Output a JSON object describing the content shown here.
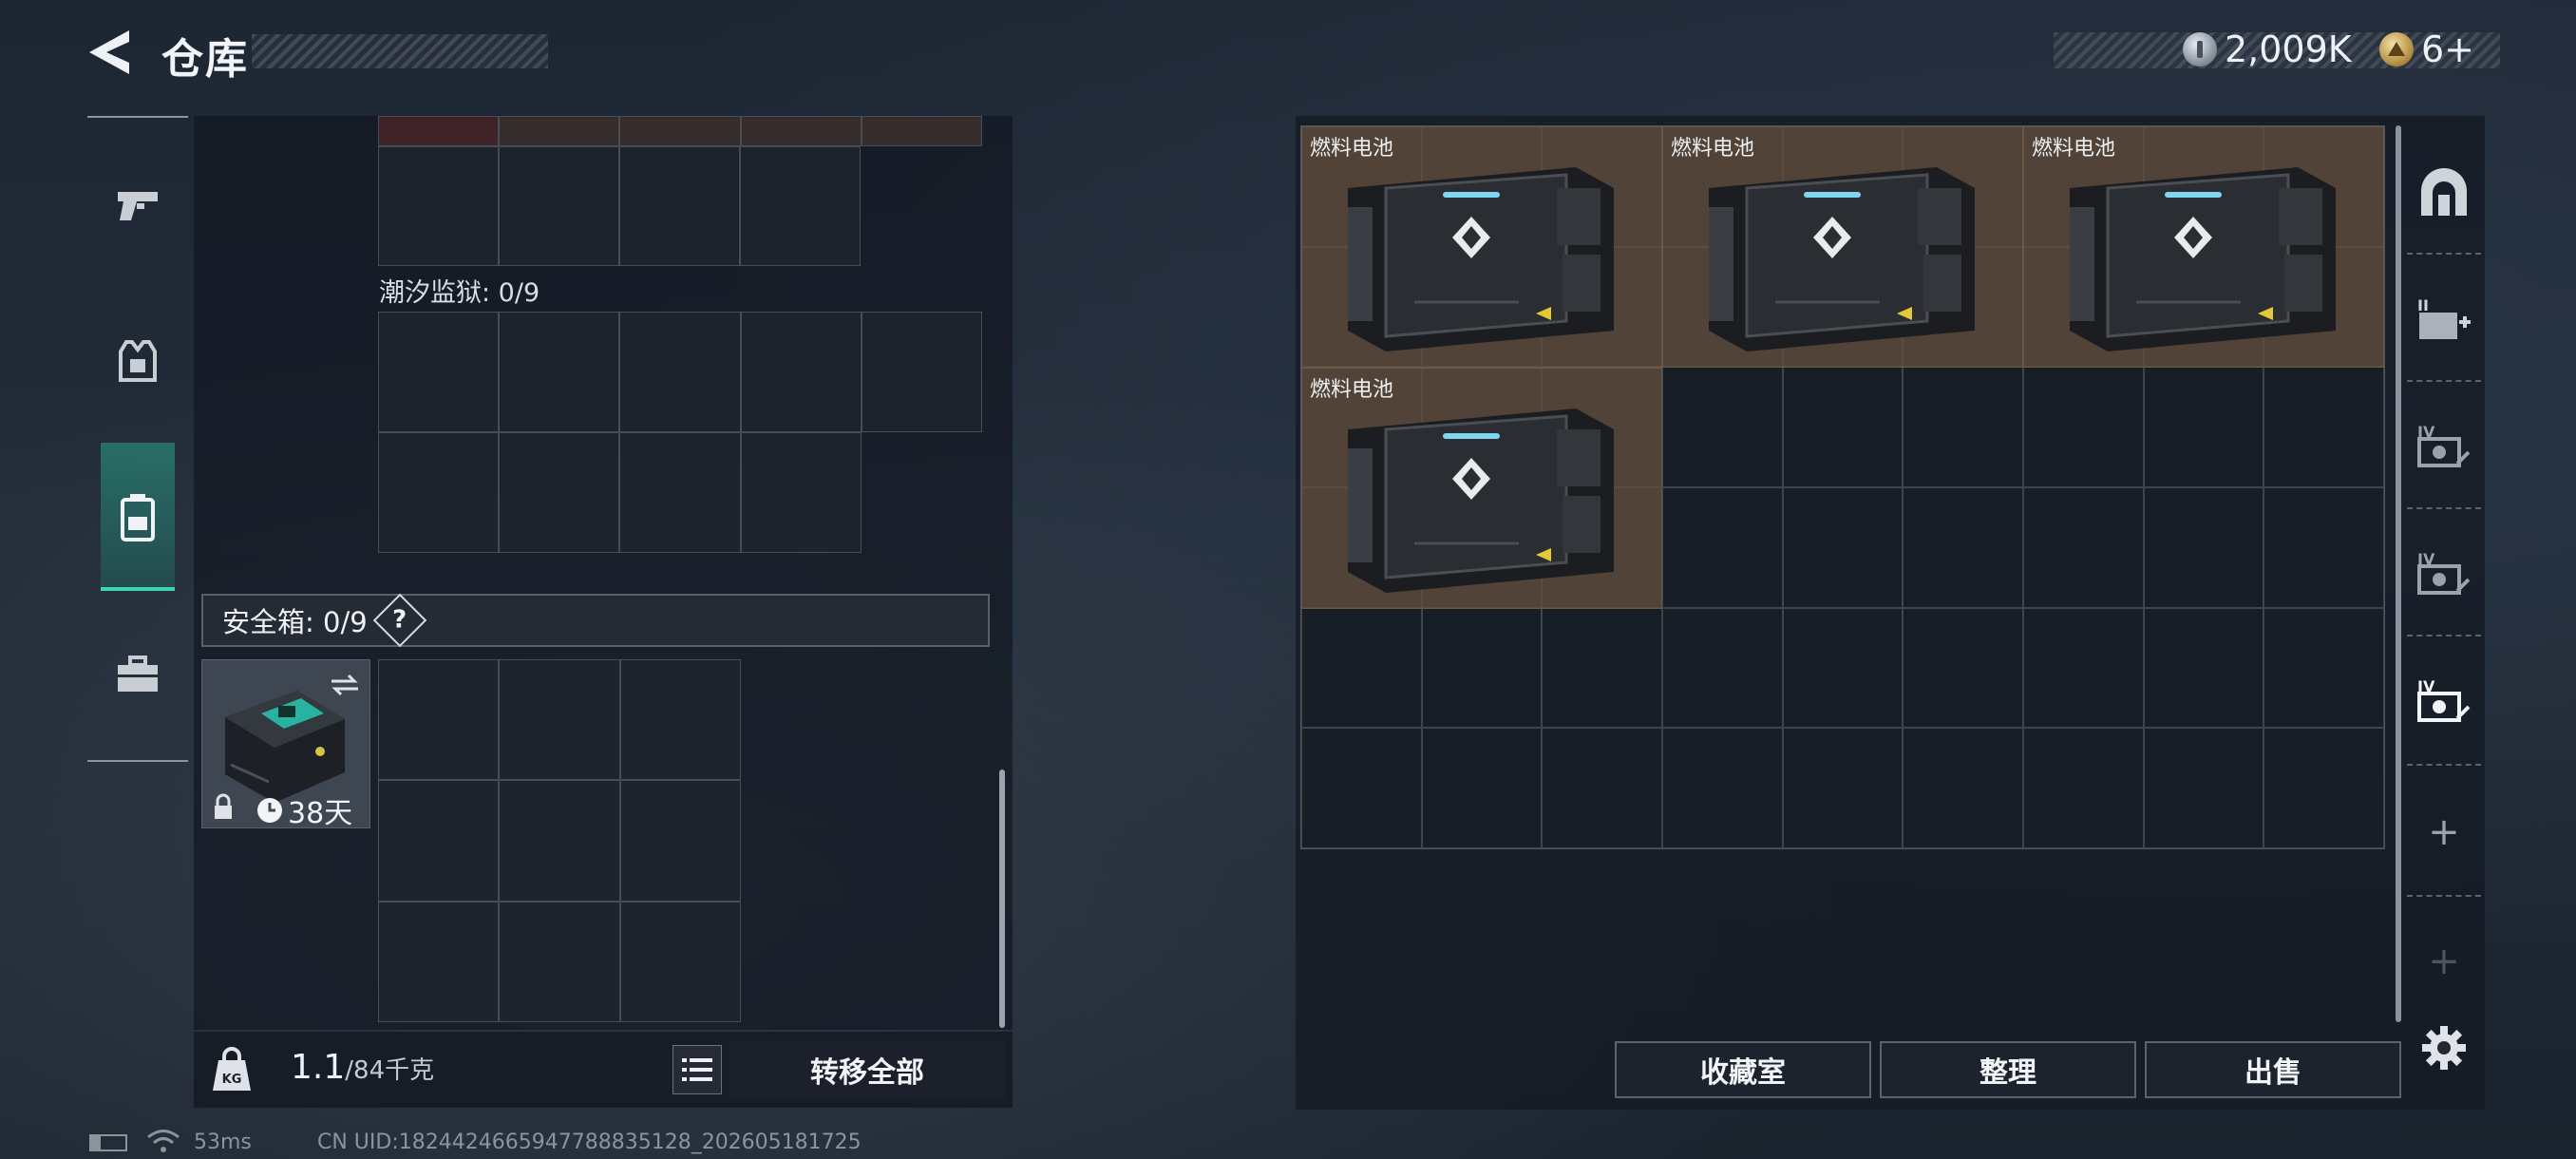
{
  "header": {
    "title": "仓库",
    "currencies": [
      {
        "icon": "silver-coin-icon",
        "value": "2,009K"
      },
      {
        "icon": "gold-coin-icon",
        "value": "6+"
      }
    ]
  },
  "left_rail": {
    "items": [
      {
        "icon": "pistol-icon",
        "active": false
      },
      {
        "icon": "armor-vest-icon",
        "active": false
      },
      {
        "icon": "backpack-icon",
        "active": true
      },
      {
        "icon": "toolbox-icon",
        "active": false
      }
    ]
  },
  "inventory": {
    "prison_label": "潮汐监狱: 0/9",
    "secure_box_label": "安全箱: 0/9",
    "help_mark": "?",
    "secure_item": {
      "duration": "38天"
    },
    "weight_current": "1.1",
    "weight_max": "/84千克",
    "transfer_all": "转移全部",
    "kg_badge": "KG"
  },
  "stash": {
    "items": [
      {
        "name": "燃料电池"
      },
      {
        "name": "燃料电池"
      },
      {
        "name": "燃料电池"
      },
      {
        "name": "燃料电池"
      }
    ],
    "rail": [
      "vault-icon",
      "add-container-icon",
      "container-iv-icon",
      "container-iv-icon",
      "container-iv-active-icon",
      "plus-icon",
      "plus-icon"
    ],
    "plus": "+",
    "buttons": {
      "collection": "收藏室",
      "organize": "整理",
      "sell": "出售"
    }
  },
  "status_bar": {
    "ping": "53ms",
    "uid": "CN UID:1824424665947788835128_202605181725"
  },
  "colors": {
    "accent": "#40d3b2",
    "item_bg": "#624e3d",
    "panel": "#141a23"
  }
}
